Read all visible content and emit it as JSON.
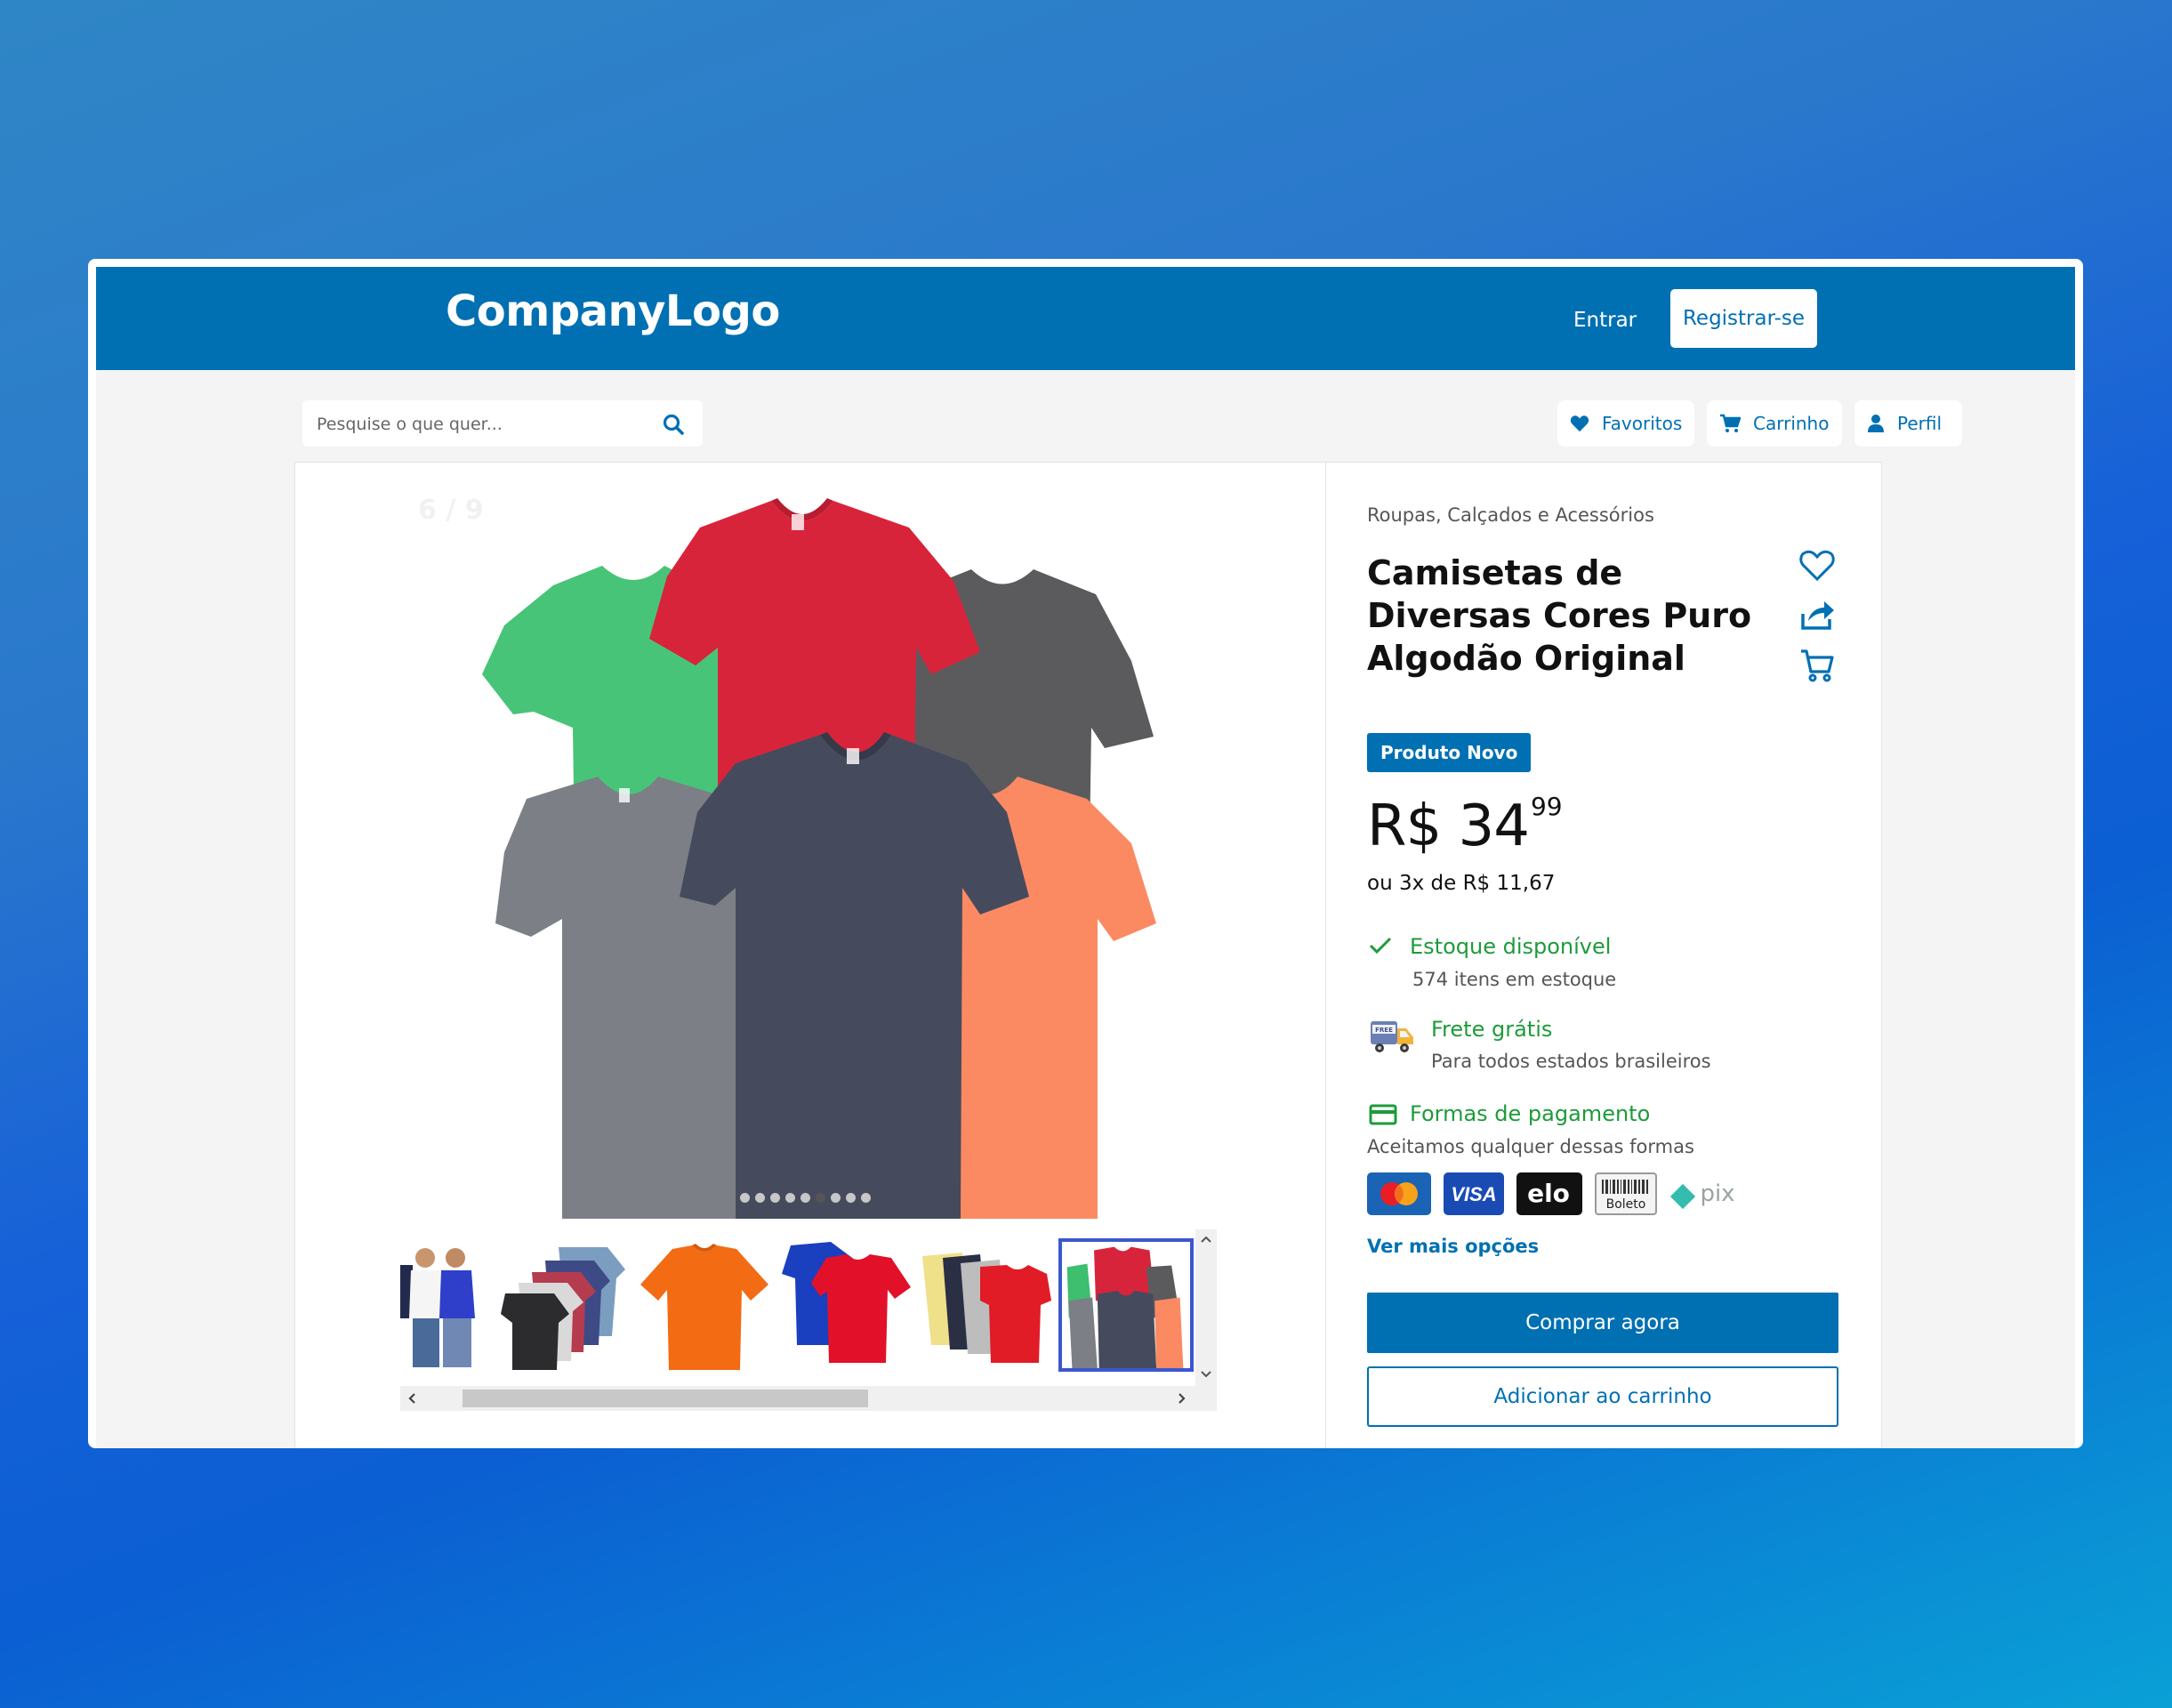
{
  "header": {
    "logo": "CompanyLogo",
    "login_label": "Entrar",
    "register_label": "Registrar-se"
  },
  "search": {
    "placeholder": "Pesquise o que quer..."
  },
  "nav": {
    "favorites": "Favoritos",
    "cart": "Carrinho",
    "profile": "Perfil"
  },
  "gallery": {
    "counter": "6 / 9",
    "current_index": 6,
    "total_images": 9,
    "main_image_icon": "tshirt-group-image",
    "thumbnails": [
      "models-tshirts",
      "stacked-tshirts",
      "orange-tshirt",
      "blue-red-tshirts",
      "colored-tshirts-row",
      "six-tshirts"
    ],
    "selected_thumbnail": 6
  },
  "product": {
    "category": "Roupas, Calçados e Acessórios",
    "title": "Camisetas de Diversas Cores Puro Algodão Original",
    "badge": "Produto Novo",
    "price_main": "R$ 34",
    "price_cents": "99",
    "installments": "ou 3x de R$ 11,67"
  },
  "stock": {
    "title": "Estoque disponível",
    "detail": "574 itens em estoque"
  },
  "shipping": {
    "title": "Frete grátis",
    "detail": "Para todos estados brasileiros",
    "truck_label": "FREE"
  },
  "payment": {
    "title": "Formas de pagamento",
    "detail": "Aceitamos qualquer dessas formas",
    "methods": [
      "mastercard",
      "VISA",
      "elo",
      "Boleto",
      "pix"
    ],
    "more_label": "Ver mais opções"
  },
  "actions": {
    "buy_label": "Comprar agora",
    "add_cart_label": "Adicionar ao carrinho"
  },
  "colors": {
    "primary": "#0070b3",
    "success": "#1d9b3a",
    "selected_thumb_border": "#3b57cf"
  }
}
